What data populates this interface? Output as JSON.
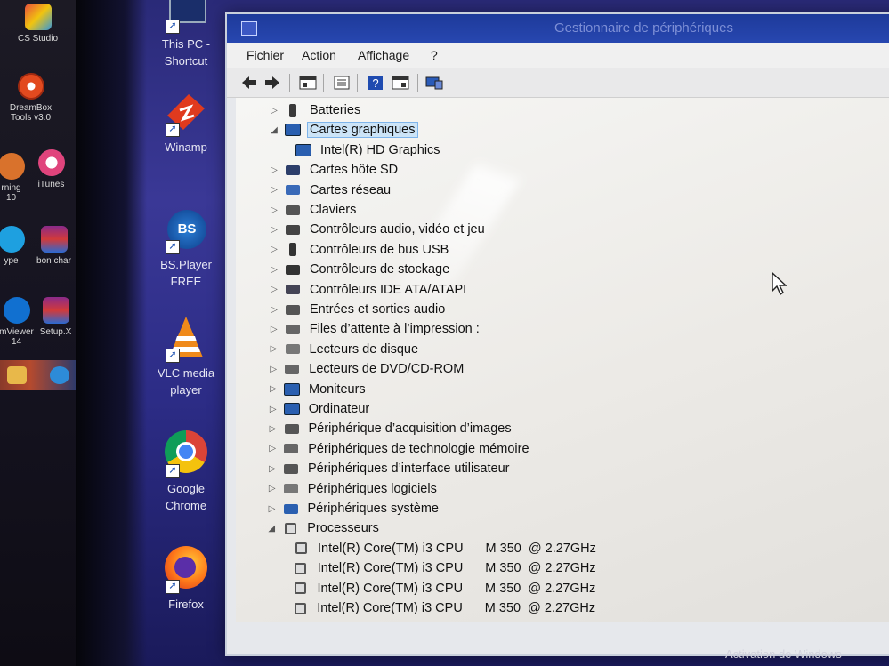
{
  "left_desktop": {
    "icons": [
      {
        "label": "CS Studio",
        "icon": "cs-studio-icon"
      },
      {
        "label": "DreamBox",
        "label2": "Tools v3.0",
        "icon": "dreambox-icon"
      },
      {
        "label": "rning",
        "label2": "10",
        "icon": "app-icon"
      },
      {
        "label": "iTunes",
        "icon": "itunes-icon"
      },
      {
        "label": "ype",
        "icon": "skype-icon"
      },
      {
        "label": "bon char",
        "icon": "winrar-icon"
      },
      {
        "label": "mViewer",
        "label2": "14",
        "icon": "teamviewer-icon"
      },
      {
        "label": "Setup.X",
        "icon": "setup-icon"
      }
    ]
  },
  "desktop_icons": [
    {
      "label": "This PC -",
      "label2": "Shortcut",
      "icon": "this-pc-icon"
    },
    {
      "label": "Winamp",
      "icon": "winamp-icon"
    },
    {
      "label": "BS.Player",
      "label2": "FREE",
      "icon": "bsplayer-icon"
    },
    {
      "label": "VLC media",
      "label2": "player",
      "icon": "vlc-icon"
    },
    {
      "label": "Google",
      "label2": "Chrome",
      "icon": "chrome-icon"
    },
    {
      "label": "Firefox",
      "icon": "firefox-icon"
    }
  ],
  "window": {
    "title": "Gestionnaire de périphériques",
    "menu": [
      "Fichier",
      "Action",
      "Affichage",
      "?"
    ],
    "toolbar": [
      "back-icon",
      "forward-icon",
      "properties-icon",
      "show-hide-icon",
      "help-icon",
      "view-icon",
      "scan-icon"
    ]
  },
  "tree": [
    {
      "label": "Batteries",
      "state": "collapsed",
      "icon": "battery-icon"
    },
    {
      "label": "Cartes graphiques",
      "state": "expanded",
      "selected": true,
      "icon": "display-adapter-icon"
    },
    {
      "label": "Intel(R) HD Graphics",
      "child": true,
      "icon": "display-adapter-icon"
    },
    {
      "label": "Cartes hôte SD",
      "state": "collapsed",
      "icon": "sd-host-icon"
    },
    {
      "label": "Cartes réseau",
      "state": "collapsed",
      "icon": "network-icon"
    },
    {
      "label": "Claviers",
      "state": "collapsed",
      "icon": "keyboard-icon"
    },
    {
      "label": "Contrôleurs audio, vidéo et jeu",
      "state": "collapsed",
      "icon": "speaker-icon"
    },
    {
      "label": "Contrôleurs de bus USB",
      "state": "collapsed",
      "icon": "usb-icon"
    },
    {
      "label": "Contrôleurs de stockage",
      "state": "collapsed",
      "icon": "storage-icon"
    },
    {
      "label": "Contrôleurs IDE ATA/ATAPI",
      "state": "collapsed",
      "icon": "ide-icon"
    },
    {
      "label": "Entrées et sorties audio",
      "state": "collapsed",
      "icon": "audio-io-icon"
    },
    {
      "label": "Files d’attente à l’impression :",
      "state": "collapsed",
      "icon": "printer-icon"
    },
    {
      "label": "Lecteurs de disque",
      "state": "collapsed",
      "icon": "disk-icon"
    },
    {
      "label": "Lecteurs de DVD/CD-ROM",
      "state": "collapsed",
      "icon": "dvd-icon"
    },
    {
      "label": "Moniteurs",
      "state": "collapsed",
      "icon": "monitor-icon"
    },
    {
      "label": "Ordinateur",
      "state": "collapsed",
      "icon": "computer-icon"
    },
    {
      "label": "Périphérique d’acquisition d’images",
      "state": "collapsed",
      "icon": "camera-icon"
    },
    {
      "label": "Périphériques de technologie mémoire",
      "state": "collapsed",
      "icon": "memory-icon"
    },
    {
      "label": "Périphériques d’interface utilisateur",
      "state": "collapsed",
      "icon": "hid-icon"
    },
    {
      "label": "Périphériques logiciels",
      "state": "collapsed",
      "icon": "software-device-icon"
    },
    {
      "label": "Périphériques système",
      "state": "collapsed",
      "icon": "system-device-icon"
    },
    {
      "label": "Processeurs",
      "state": "expanded",
      "icon": "processor-icon"
    },
    {
      "label": "Intel(R) Core(TM) i3 CPU",
      "extra": "M 350  @ 2.27GHz",
      "child": true,
      "icon": "processor-icon"
    },
    {
      "label": "Intel(R) Core(TM) i3 CPU",
      "extra": "M 350  @ 2.27GHz",
      "child": true,
      "icon": "processor-icon"
    },
    {
      "label": "Intel(R) Core(TM) i3 CPU",
      "extra": "M 350  @ 2.27GHz",
      "child": true,
      "icon": "processor-icon"
    },
    {
      "label": "Intel(R) Core(TM) i3 CPU",
      "extra": "M 350  @ 2.27GHz",
      "child": true,
      "icon": "processor-icon"
    }
  ],
  "watermark": "Activation de Windows"
}
